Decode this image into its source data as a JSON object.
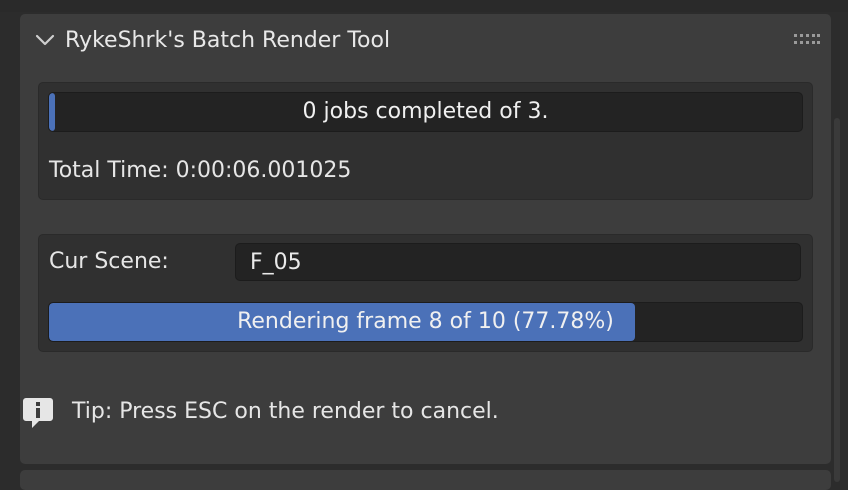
{
  "panel": {
    "title": "RykeShrk's Batch Render Tool",
    "collapse_icon": "chevron-down-icon",
    "drag_icon": "grip-dots-icon"
  },
  "jobs": {
    "progress_label": "0 jobs completed of 3.",
    "progress_fraction": 0.0,
    "total_time_label": "Total Time: 0:00:06.001025"
  },
  "scene": {
    "label": "Cur Scene:",
    "value": "F_05"
  },
  "render": {
    "progress_label": "Rendering frame 8 of 10 (77.78%)",
    "progress_fraction": 0.7778
  },
  "tip": {
    "icon": "info-speech-bubble-icon",
    "text": "Tip: Press ESC on the render to cancel."
  },
  "colors": {
    "accent": "#4b71b8",
    "panel_bg": "#3d3d3d",
    "box_bg": "#303030",
    "field_bg": "#232323"
  }
}
